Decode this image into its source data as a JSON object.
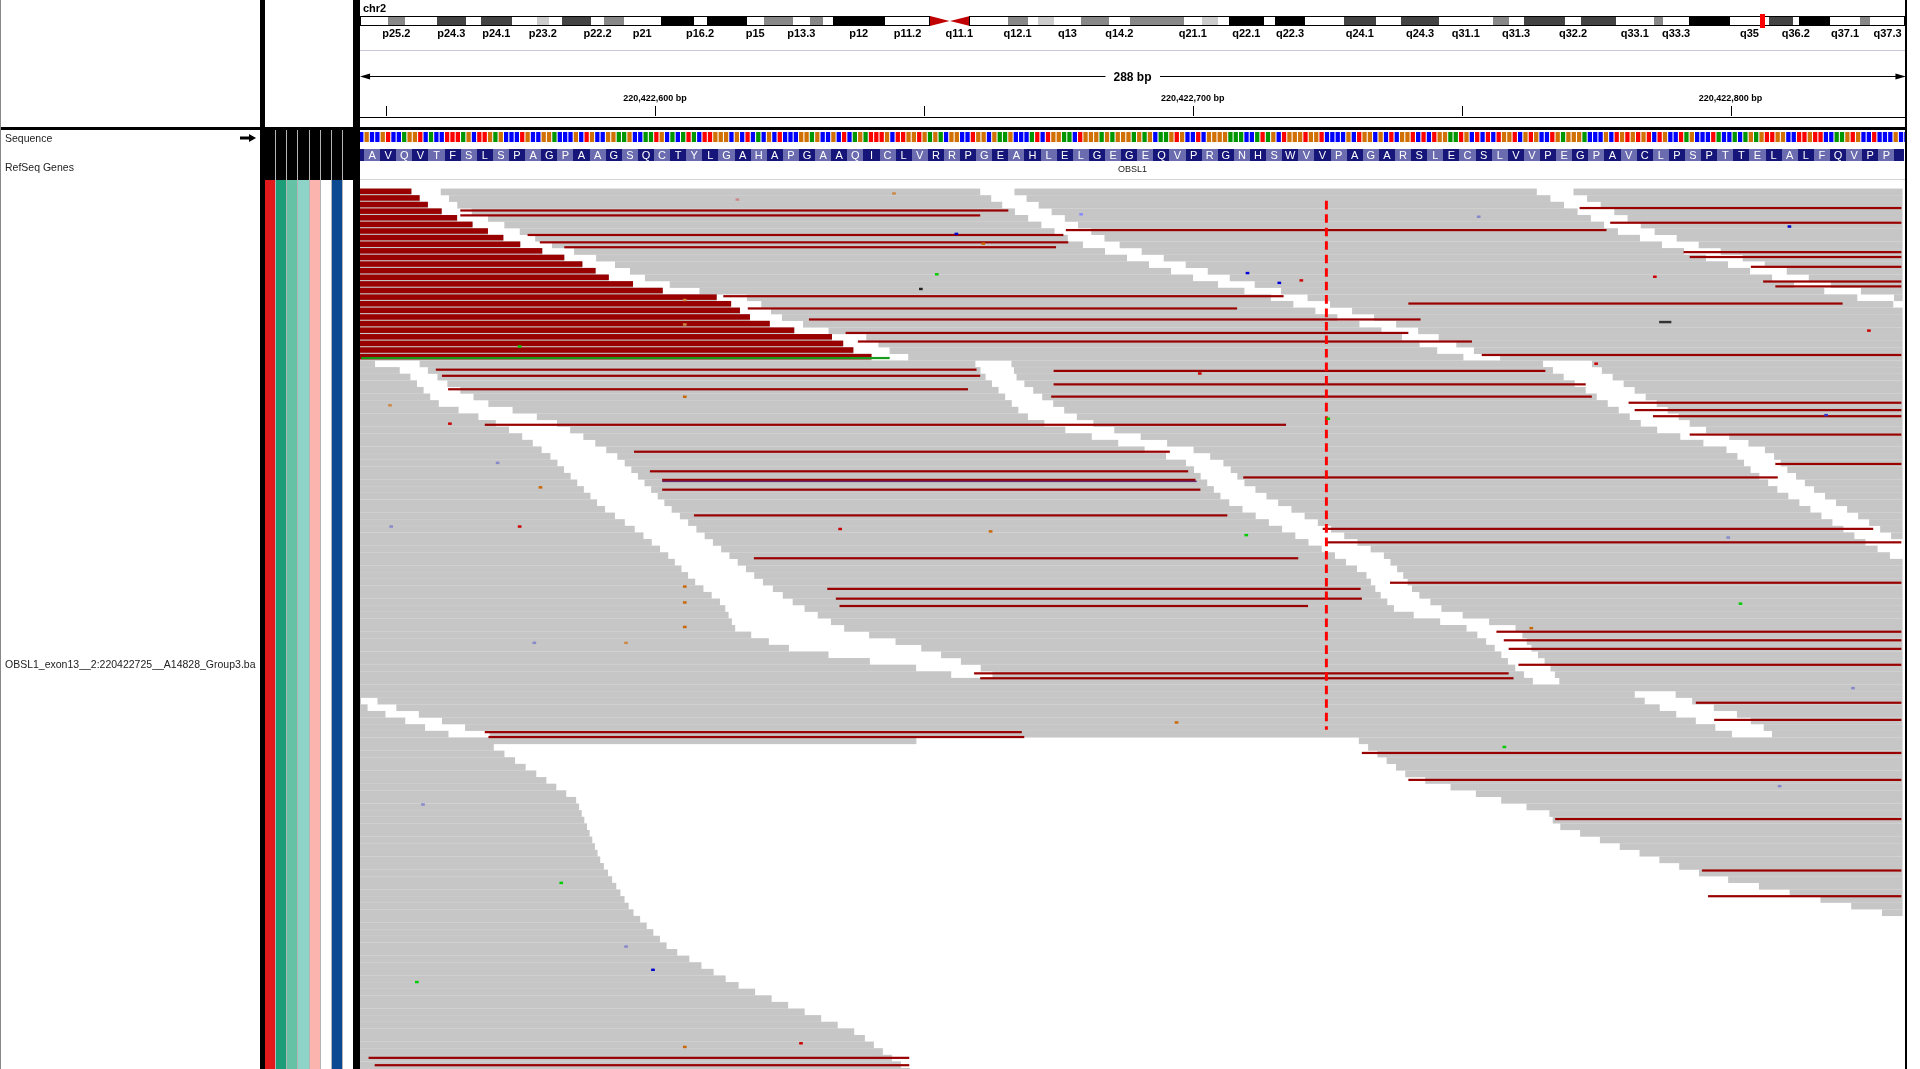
{
  "ideogram": {
    "chromosome": "chr2",
    "bands": [
      {
        "kind": "band",
        "color": "#ffffff",
        "in_view": false
      },
      {
        "kind": "band",
        "color": "#888888",
        "label": "p25.2",
        "in_view": false
      },
      {
        "kind": "band",
        "color": "#ffffff",
        "in_view": false
      },
      {
        "kind": "band",
        "color": "#444444",
        "label": "p24.3",
        "in_view": false
      },
      {
        "kind": "band",
        "color": "#ffffff",
        "in_view": false
      },
      {
        "kind": "band",
        "color": "#444444",
        "label": "p24.1",
        "in_view": false
      },
      {
        "kind": "band",
        "color": "#ffffff",
        "in_view": false
      },
      {
        "kind": "band",
        "color": "#cccccc",
        "label": "p23.2",
        "in_view": false
      },
      {
        "kind": "band",
        "color": "#ffffff",
        "in_view": false
      },
      {
        "kind": "band",
        "color": "#444444",
        "in_view": false
      },
      {
        "kind": "band",
        "color": "#ffffff",
        "label": "p22.2",
        "in_view": false
      },
      {
        "kind": "band",
        "color": "#888888",
        "in_view": false
      },
      {
        "kind": "band",
        "color": "#ffffff",
        "label": "p21",
        "in_view": false
      },
      {
        "kind": "band",
        "color": "#000000",
        "in_view": false
      },
      {
        "kind": "band",
        "color": "#ffffff",
        "label": "p16.2",
        "in_view": false
      },
      {
        "kind": "band",
        "color": "#000000",
        "in_view": false
      },
      {
        "kind": "band",
        "color": "#ffffff",
        "label": "p15",
        "in_view": false
      },
      {
        "kind": "band",
        "color": "#888888",
        "in_view": false
      },
      {
        "kind": "band",
        "color": "#ffffff",
        "label": "p13.3",
        "in_view": false
      },
      {
        "kind": "band",
        "color": "#888888",
        "in_view": false
      },
      {
        "kind": "band",
        "color": "#ffffff",
        "in_view": false
      },
      {
        "kind": "band",
        "color": "#000000",
        "label": "p12",
        "in_view": false
      },
      {
        "kind": "band",
        "color": "#ffffff",
        "label": "p11.2",
        "in_view": false
      },
      {
        "kind": "centromere",
        "color": "#c00000",
        "in_view": false
      },
      {
        "kind": "centromere",
        "color": "#c00000",
        "label": "q11.1",
        "in_view": false
      },
      {
        "kind": "band",
        "color": "#ffffff",
        "in_view": false
      },
      {
        "kind": "band",
        "color": "#888888",
        "label": "q12.1",
        "in_view": false
      },
      {
        "kind": "band",
        "color": "#ffffff",
        "in_view": false
      },
      {
        "kind": "band",
        "color": "#cccccc",
        "in_view": false
      },
      {
        "kind": "band",
        "color": "#ffffff",
        "label": "q13",
        "in_view": false
      },
      {
        "kind": "band",
        "color": "#888888",
        "in_view": false
      },
      {
        "kind": "band",
        "color": "#ffffff",
        "label": "q14.2",
        "in_view": false
      },
      {
        "kind": "band",
        "color": "#888888",
        "in_view": false
      },
      {
        "kind": "band",
        "color": "#ffffff",
        "label": "q21.1",
        "in_view": false
      },
      {
        "kind": "band",
        "color": "#cccccc",
        "in_view": false
      },
      {
        "kind": "band",
        "color": "#ffffff",
        "in_view": false
      },
      {
        "kind": "band",
        "color": "#000000",
        "label": "q22.1",
        "in_view": false
      },
      {
        "kind": "band",
        "color": "#ffffff",
        "in_view": false
      },
      {
        "kind": "band",
        "color": "#000000",
        "label": "q22.3",
        "in_view": false
      },
      {
        "kind": "band",
        "color": "#ffffff",
        "in_view": false
      },
      {
        "kind": "band",
        "color": "#444444",
        "label": "q24.1",
        "in_view": false
      },
      {
        "kind": "band",
        "color": "#ffffff",
        "in_view": false
      },
      {
        "kind": "band",
        "color": "#444444",
        "label": "q24.3",
        "in_view": false
      },
      {
        "kind": "band",
        "color": "#ffffff",
        "label": "q31.1",
        "in_view": false
      },
      {
        "kind": "band",
        "color": "#888888",
        "in_view": false
      },
      {
        "kind": "band",
        "color": "#ffffff",
        "label": "q31.3",
        "in_view": false
      },
      {
        "kind": "band",
        "color": "#444444",
        "in_view": false
      },
      {
        "kind": "band",
        "color": "#ffffff",
        "label": "q32.2",
        "in_view": false
      },
      {
        "kind": "band",
        "color": "#444444",
        "in_view": false
      },
      {
        "kind": "band",
        "color": "#ffffff",
        "label": "q33.1",
        "in_view": false
      },
      {
        "kind": "band",
        "color": "#888888",
        "in_view": false
      },
      {
        "kind": "band",
        "color": "#ffffff",
        "label": "q33.3",
        "in_view": false
      },
      {
        "kind": "band",
        "color": "#000000",
        "in_view": false
      },
      {
        "kind": "band",
        "color": "#ffffff",
        "label": "q35",
        "in_view": true
      },
      {
        "kind": "band",
        "color": "#444444",
        "in_view": false
      },
      {
        "kind": "band",
        "color": "#ffffff",
        "label": "q36.2",
        "in_view": false
      },
      {
        "kind": "band",
        "color": "#000000",
        "in_view": false
      },
      {
        "kind": "band",
        "color": "#ffffff",
        "label": "q37.1",
        "in_view": false
      },
      {
        "kind": "band",
        "color": "#888888",
        "in_view": false
      },
      {
        "kind": "band",
        "color": "#ffffff",
        "label": "q37.3",
        "in_view": false
      }
    ]
  },
  "ruler": {
    "span": "288 bp",
    "tick_labels": [
      "220,422,600 bp",
      "220,422,700 bp",
      "220,422,800 bp"
    ]
  },
  "tracks": [
    {
      "kind": "sequence",
      "name": "Sequence",
      "forward_strand": true,
      "attributes": [
        {
          "color": "#000000"
        },
        {
          "color": "#000000"
        },
        {
          "color": "#000000"
        },
        {
          "color": "#000000"
        },
        {
          "color": "#000000"
        },
        {
          "color": "#000000"
        },
        {
          "color": "#000000"
        },
        {
          "color": "#000000"
        }
      ]
    },
    {
      "kind": "gene",
      "name": "RefSeq Genes",
      "gene": "OBSL1",
      "amino_acids": [
        "A",
        "V",
        "Q",
        "V",
        "T",
        "F",
        "S",
        "L",
        "S",
        "P",
        "A",
        "G",
        "P",
        "A",
        "A",
        "G",
        "S",
        "Q",
        "C",
        "T",
        "Y",
        "L",
        "G",
        "A",
        "H",
        "A",
        "P",
        "G",
        "A",
        "A",
        "Q",
        "I",
        "C",
        "L",
        "V",
        "R",
        "R",
        "P",
        "G",
        "E",
        "A",
        "H",
        "L",
        "E",
        "L",
        "G",
        "E",
        "G",
        "E",
        "Q",
        "V",
        "P",
        "R",
        "G",
        "N",
        "H",
        "S",
        "W",
        "V",
        "V",
        "P",
        "A",
        "G",
        "A",
        "R",
        "S",
        "L",
        "E",
        "C",
        "S",
        "L",
        "V",
        "V",
        "P",
        "E",
        "G",
        "P",
        "A",
        "V",
        "C",
        "L",
        "P",
        "S",
        "P",
        "T",
        "T",
        "E",
        "L",
        "A",
        "L",
        "F",
        "Q",
        "V",
        "P",
        "P"
      ],
      "attributes": [
        {
          "color": "#000000"
        },
        {
          "color": "#000000"
        },
        {
          "color": "#000000"
        },
        {
          "color": "#000000"
        },
        {
          "color": "#000000"
        },
        {
          "color": "#000000"
        },
        {
          "color": "#000000"
        },
        {
          "color": "#000000"
        }
      ]
    },
    {
      "kind": "alignment",
      "name": "OBSL1_exon13__2:220422725__A14828_Group3.ba",
      "attributes": [
        {
          "color": "#e31a1c"
        },
        {
          "color": "#1b9e77"
        },
        {
          "color": "#66c2a5"
        },
        {
          "color": "#8dd3c7"
        },
        {
          "color": "#fbb4ae"
        },
        {
          "color": "#ffffff"
        },
        {
          "color": "#0b4a92"
        },
        {
          "color": "#ffffff"
        }
      ]
    }
  ]
}
